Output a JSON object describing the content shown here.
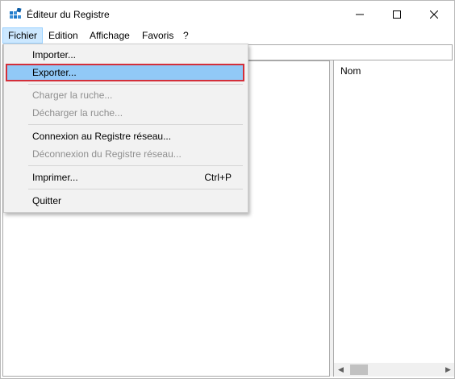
{
  "window": {
    "title": "Éditeur du Registre",
    "app_icon": "registry-editor-icon",
    "controls": [
      "minimize-icon",
      "maximize-icon",
      "close-icon"
    ]
  },
  "menubar": {
    "items": [
      {
        "label": "Fichier",
        "active": true
      },
      {
        "label": "Edition"
      },
      {
        "label": "Affichage"
      },
      {
        "label": "Favoris"
      },
      {
        "label": "?"
      }
    ]
  },
  "file_menu": {
    "items": [
      {
        "label": "Importer...",
        "enabled": true
      },
      {
        "label": "Exporter...",
        "enabled": true,
        "highlighted": true
      },
      {
        "label": "Charger la ruche...",
        "enabled": false
      },
      {
        "label": "Décharger la ruche...",
        "enabled": false
      },
      {
        "label": "Connexion au Registre réseau...",
        "enabled": true
      },
      {
        "label": "Déconnexion du Registre réseau...",
        "enabled": false
      },
      {
        "label": "Imprimer...",
        "shortcut": "Ctrl+P",
        "enabled": true
      },
      {
        "label": "Quitter",
        "enabled": true
      }
    ]
  },
  "right_pane": {
    "column_header": "Nom"
  },
  "colors": {
    "highlight_fill": "#91c9f7",
    "highlight_outline": "#d32f3a",
    "menu_active_bg": "#cce8ff",
    "disabled_text": "#8f8f8f"
  }
}
